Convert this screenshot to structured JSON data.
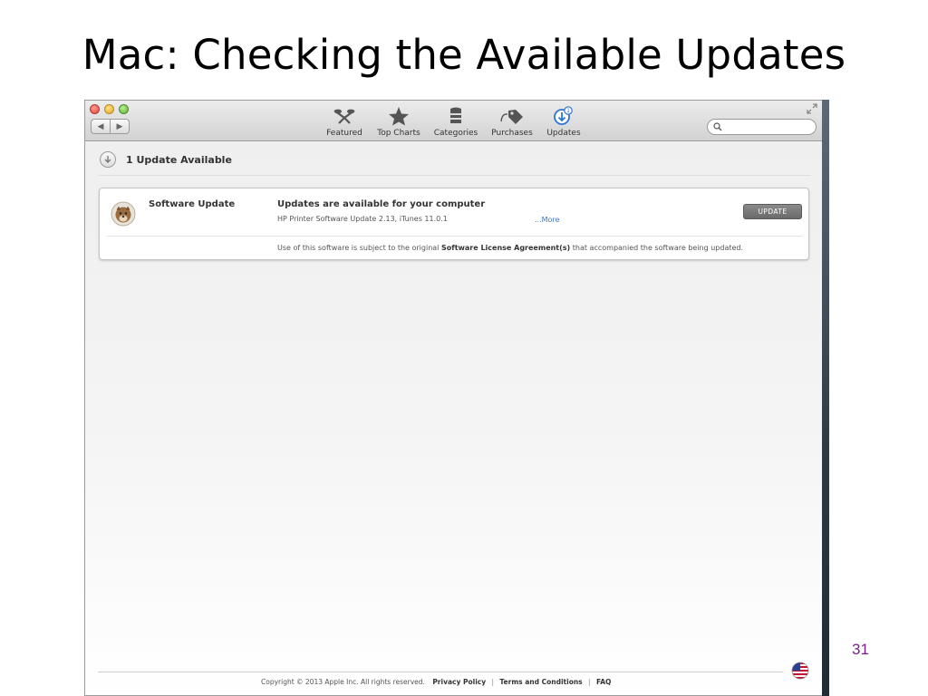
{
  "slide": {
    "title": "Mac: Checking the Available Updates",
    "page_number": "31"
  },
  "window": {
    "nav": {
      "back": "◀",
      "forward": "▶"
    },
    "tabs": [
      {
        "label": "Featured",
        "icon": "featured-icon"
      },
      {
        "label": "Top Charts",
        "icon": "star-icon"
      },
      {
        "label": "Categories",
        "icon": "categories-icon"
      },
      {
        "label": "Purchases",
        "icon": "price-tag-icon"
      },
      {
        "label": "Updates",
        "icon": "updates-icon",
        "badge": "1",
        "active": true
      }
    ],
    "search": {
      "placeholder": ""
    },
    "colors": {
      "accent": "#3b78c4",
      "button": "#7a7a7a"
    }
  },
  "updates": {
    "header": "1 Update Available",
    "items": [
      {
        "app_name": "Software Update",
        "headline": "Updates are available for your computer",
        "details": "HP Printer Software Update 2.13, iTunes 11.0.1",
        "more": "...More",
        "button": "UPDATE",
        "license_prefix": "Use of this software is subject to the original ",
        "license_link": "Software License Agreement(s)",
        "license_suffix": " that accompanied the software being updated."
      }
    ]
  },
  "footer": {
    "copyright": "Copyright © 2013 Apple Inc. All rights reserved.",
    "privacy": "Privacy Policy",
    "separator": "|",
    "terms": "Terms and Conditions",
    "faq": "FAQ"
  }
}
